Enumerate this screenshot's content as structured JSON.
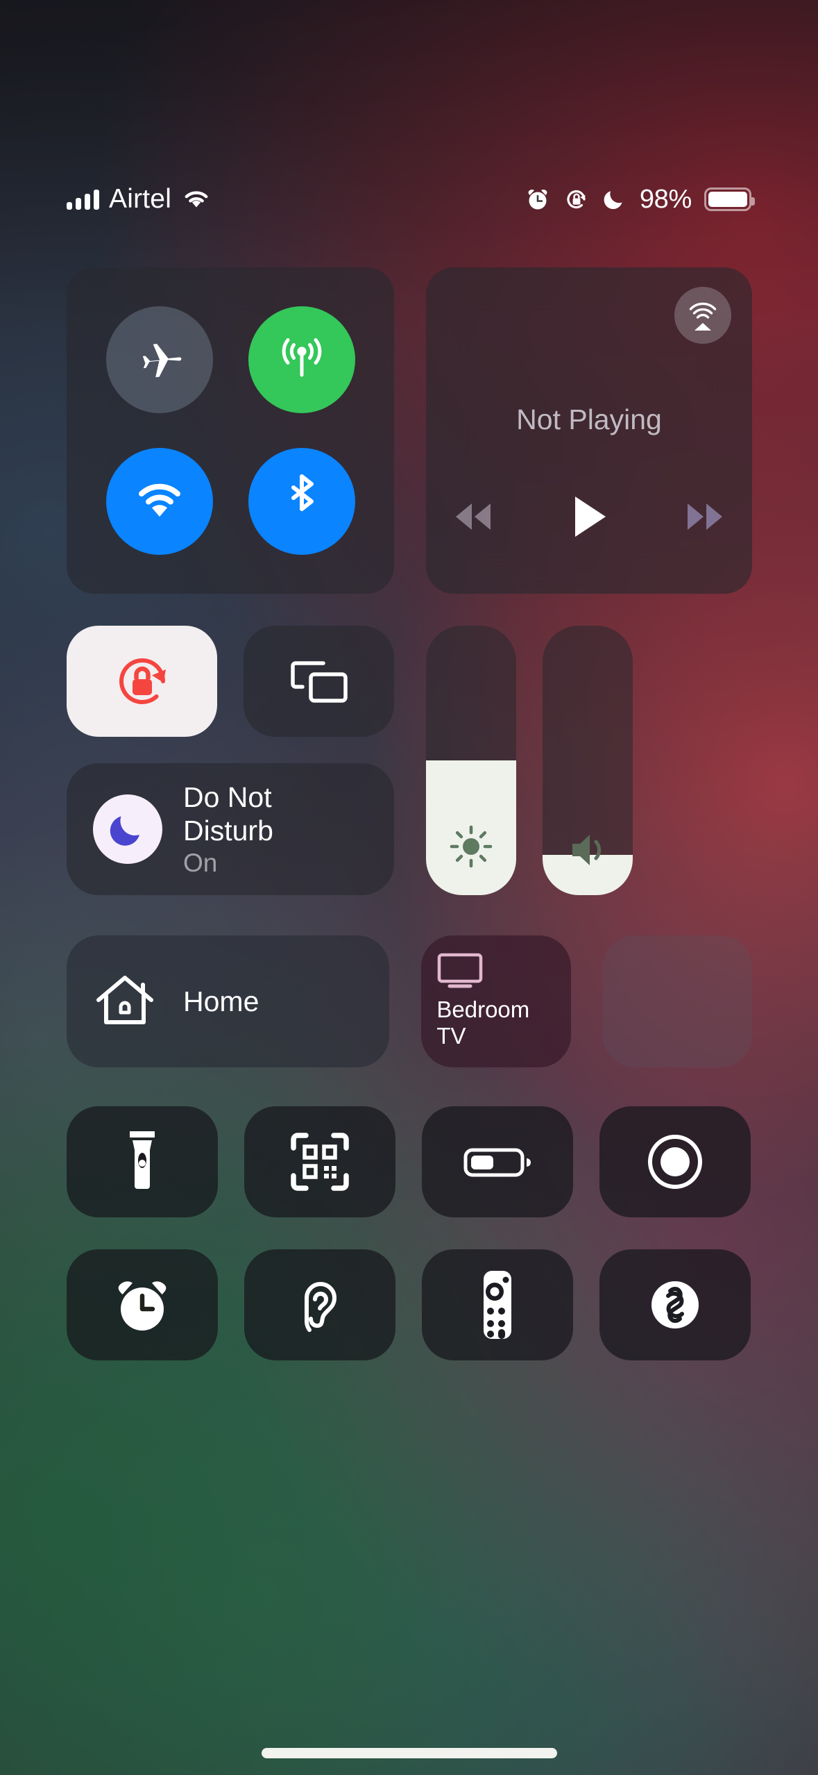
{
  "status_bar": {
    "carrier": "Airtel",
    "signal_bars": 4,
    "wifi_icon": "wifi-icon",
    "alarm_icon": "alarm-clock-icon",
    "rotation_lock_icon": "rotation-lock-icon",
    "dnd_icon": "moon-icon",
    "battery_percent": "98%",
    "battery_level": 100
  },
  "connectivity": {
    "airplane": {
      "name": "airplane-mode",
      "icon": "airplane-icon",
      "state": "off"
    },
    "cellular": {
      "name": "cellular-data",
      "icon": "cellular-antenna-icon",
      "state": "on",
      "color": "#34c759"
    },
    "wifi": {
      "name": "wifi",
      "icon": "wifi-icon",
      "state": "on",
      "color": "#0a84ff"
    },
    "bluetooth": {
      "name": "bluetooth",
      "icon": "bluetooth-icon",
      "state": "on",
      "color": "#0a84ff"
    }
  },
  "media": {
    "title": "Not Playing",
    "airplay_icon": "airplay-audio-icon",
    "rewind_icon": "rewind-icon",
    "play_icon": "play-icon",
    "forward_icon": "fast-forward-icon"
  },
  "toggles": {
    "rotation_lock": {
      "label": "Rotation Lock",
      "icon": "rotation-lock-icon",
      "state": "on",
      "accent": "#f5453f"
    },
    "screen_mirroring": {
      "label": "Screen Mirroring",
      "icon": "screen-mirroring-icon",
      "state": "off"
    }
  },
  "do_not_disturb": {
    "title": "Do Not Disturb",
    "status": "On",
    "icon": "moon-icon",
    "icon_color": "#4a45cf"
  },
  "sliders": {
    "brightness": {
      "label": "Brightness",
      "icon": "brightness-icon",
      "value": 50
    },
    "volume": {
      "label": "Volume",
      "icon": "speaker-icon",
      "value": 15
    }
  },
  "home": {
    "tile_label": "Home",
    "tile_icon": "house-icon",
    "devices": [
      {
        "label": "Bedroom TV",
        "icon": "tv-icon"
      },
      {
        "label": "",
        "icon": ""
      }
    ]
  },
  "quick_icons": [
    {
      "name": "flashlight",
      "icon": "flashlight-icon"
    },
    {
      "name": "code-scanner",
      "icon": "qr-code-icon"
    },
    {
      "name": "low-power-mode",
      "icon": "battery-icon"
    },
    {
      "name": "screen-recording",
      "icon": "record-icon"
    },
    {
      "name": "alarm",
      "icon": "alarm-clock-icon"
    },
    {
      "name": "hearing",
      "icon": "ear-icon"
    },
    {
      "name": "apple-tv-remote",
      "icon": "remote-icon"
    },
    {
      "name": "shazam",
      "icon": "shazam-icon"
    }
  ],
  "home_indicator": "home-indicator"
}
